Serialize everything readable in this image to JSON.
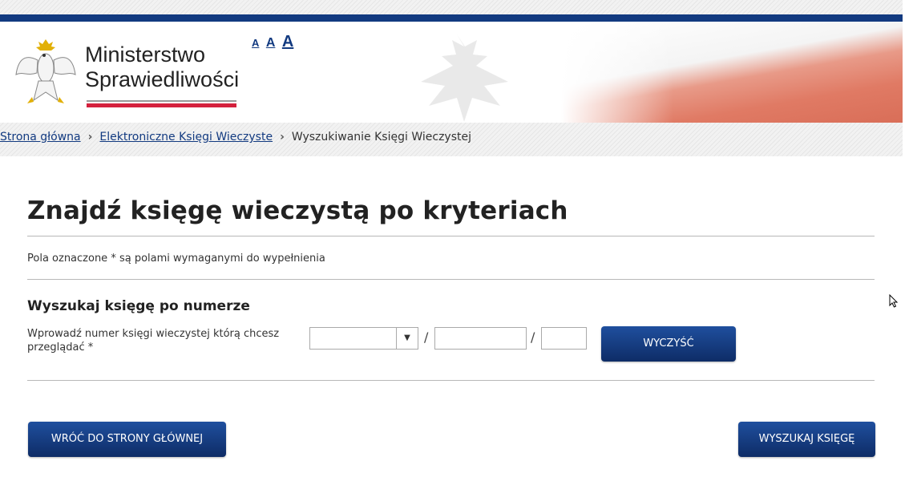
{
  "header": {
    "logo_line1": "Ministerstwo",
    "logo_line2": "Sprawiedliwości",
    "font_small": "A",
    "font_medium": "A",
    "font_large": "A"
  },
  "breadcrumb": {
    "home": "Strona główna",
    "ekw": "Elektroniczne Księgi Wieczyste",
    "current": "Wyszukiwanie Księgi Wieczystej"
  },
  "page": {
    "title": "Znajdź księgę wieczystą po kryteriach",
    "required_note": "Pola oznaczone * są polami wymaganymi do wypełnienia",
    "section_title": "Wyszukaj księgę po numerze",
    "field_label": "Wprowadź numer księgi wieczystej którą chcesz przeglądać *",
    "court_code_value": "",
    "number_value": "",
    "check_digit_value": "",
    "separator": "/",
    "clear_label": "WYCZYŚĆ",
    "back_label": "WRÓĆ DO STRONY GŁÓWNEJ",
    "search_label": "WYSZUKAJ KSIĘGĘ"
  },
  "colors": {
    "brand_blue": "#123a80",
    "flag_red": "#d4213d"
  }
}
